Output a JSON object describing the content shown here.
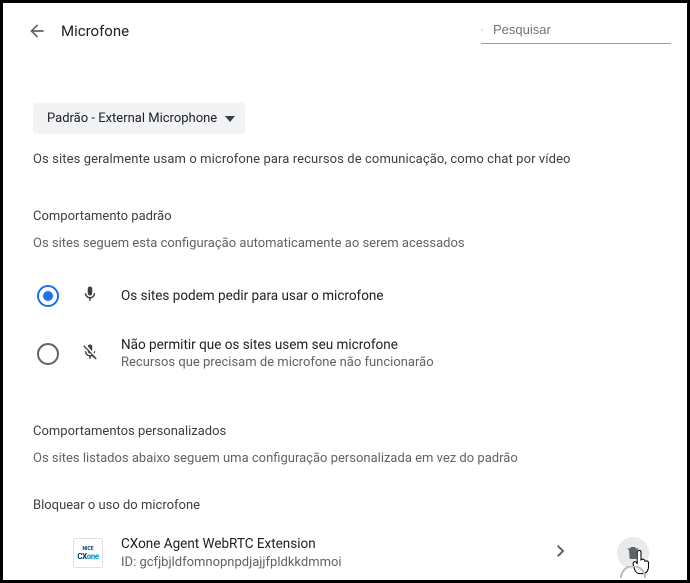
{
  "header": {
    "title": "Microfone",
    "search_placeholder": "Pesquisar"
  },
  "device_dropdown": {
    "label": "Padrão - External Microphone"
  },
  "description": "Os sites geralmente usam o microfone para recursos de comunicação, como chat por vídeo",
  "default_behavior": {
    "heading": "Comportamento padrão",
    "sub": "Os sites seguem esta configuração automaticamente ao serem acessados",
    "options": [
      {
        "title": "Os sites podem pedir para usar o microfone",
        "sub": "",
        "selected": true,
        "icon": "mic"
      },
      {
        "title": "Não permitir que os sites usem seu microfone",
        "sub": "Recursos que precisam de microfone não funcionarão",
        "selected": false,
        "icon": "mic-off"
      }
    ]
  },
  "custom": {
    "heading": "Comportamentos personalizados",
    "sub": "Os sites listados abaixo seguem uma configuração personalizada em vez do padrão",
    "block_heading": "Bloquear o uso do microfone",
    "items": [
      {
        "name": "CXone Agent WebRTC Extension",
        "id_label": "ID: gcfjbjldfomnopnpdjajjfpldkkdmmoi"
      }
    ]
  }
}
